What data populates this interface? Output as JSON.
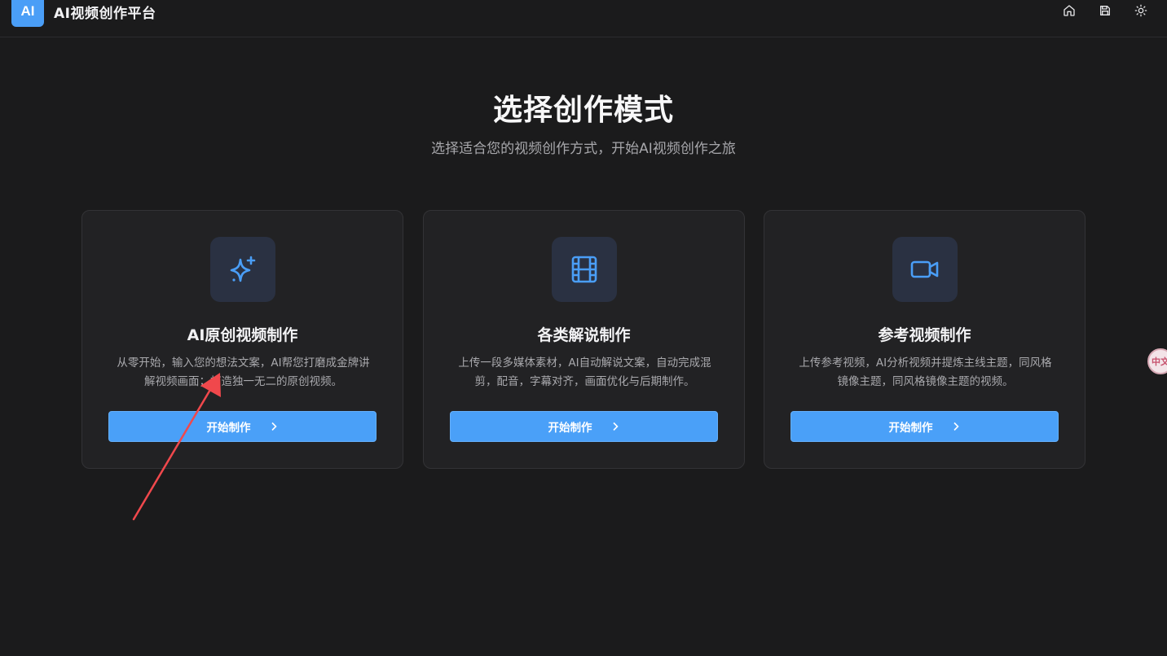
{
  "app": {
    "logo_text": "AI",
    "title": "AI视频创作平台"
  },
  "header_icons": [
    "home-icon",
    "save-icon",
    "sun-icon"
  ],
  "main": {
    "title": "选择创作模式",
    "subtitle": "选择适合您的视频创作方式，开始AI视频创作之旅"
  },
  "cards": [
    {
      "icon": "sparkles-icon",
      "title": "AI原创视频制作",
      "desc_line1": "从零开始，输入您的想法文案，AI帮您打磨成金牌讲",
      "desc_line2": "解视频画面；打造独一无二的原创视频。",
      "button": "开始制作"
    },
    {
      "icon": "film-icon",
      "title": "各类解说制作",
      "desc_line1": "上传一段多媒体素材，AI自动解说文案，自动完成混",
      "desc_line2": "剪，配音，字幕对齐，画面优化与后期制作。",
      "button": "开始制作"
    },
    {
      "icon": "video-camera-icon",
      "title": "参考视频制作",
      "desc_line1": "上传参考视频，AI分析视频并提炼主线主题，同风格",
      "desc_line2": "镜像主题，同风格镜像主题的视频。",
      "button": "开始制作"
    }
  ],
  "side_widget": {
    "text": "中文"
  },
  "colors": {
    "accent": "#4aa0f8",
    "background": "#1b1b1c",
    "card": "#222224",
    "annotation_arrow": "#f0484c"
  }
}
